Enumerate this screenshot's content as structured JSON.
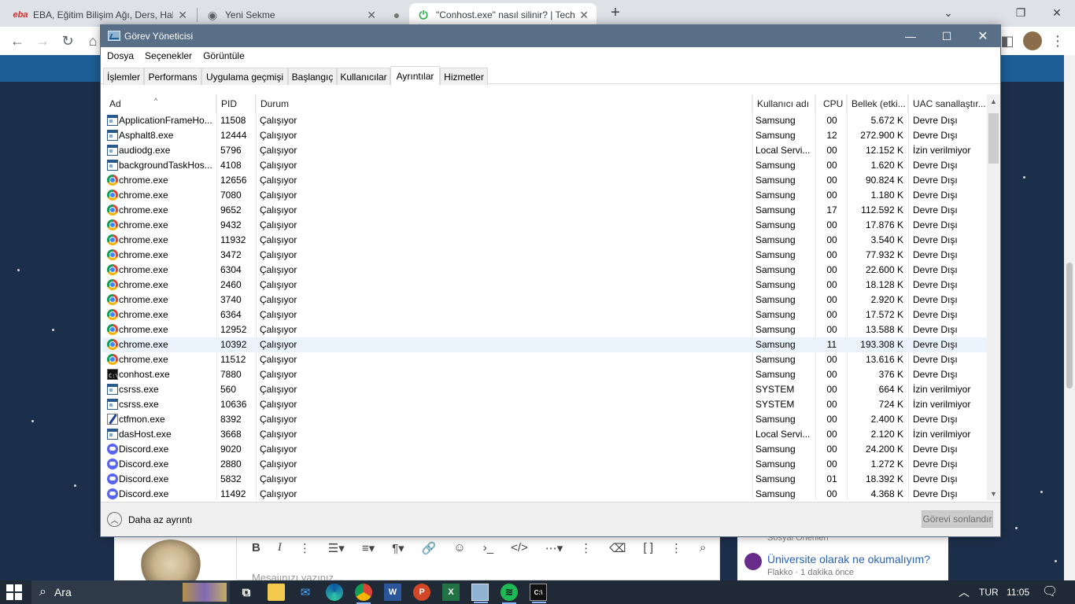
{
  "browser": {
    "tabs": [
      {
        "label": "EBA, Eğitim Bilişim Ağı, Ders, Hab",
        "favicon": "eba"
      },
      {
        "label": "Yeni Sekme"
      },
      {
        "label": "\"Conhost.exe\" nasıl silinir? | Techn"
      }
    ],
    "new_tab_icon": "+",
    "minimize_icon": "⌄",
    "restore_icon": "❐",
    "close_icon": "✕"
  },
  "site": {
    "editor_placeholder": "Mesajınızı yazınız...",
    "side_small": "Sosyal Önerilen",
    "side_title": "Üniversite olarak ne okumalıyım?",
    "side_meta": "Flakko · 1 dakika önce"
  },
  "taskmgr": {
    "title": "Görev Yöneticisi",
    "menu": [
      "Dosya",
      "Seçenekler",
      "Görüntüle"
    ],
    "tabs": [
      "İşlemler",
      "Performans",
      "Uygulama geçmişi",
      "Başlangıç",
      "Kullanıcılar",
      "Ayrıntılar",
      "Hizmetler"
    ],
    "active_tab": "Ayrıntılar",
    "columns": {
      "name": "Ad",
      "pid": "PID",
      "status": "Durum",
      "user": "Kullanıcı adı",
      "cpu": "CPU",
      "mem": "Bellek (etki...",
      "uac": "UAC sanallaştır..."
    },
    "rows": [
      {
        "name": "ApplicationFrameHo...",
        "pid": "11508",
        "status": "Çalışıyor",
        "user": "Samsung",
        "cpu": "00",
        "mem": "5.672 K",
        "uac": "Devre Dışı",
        "icon": "app"
      },
      {
        "name": "Asphalt8.exe",
        "pid": "12444",
        "status": "Çalışıyor",
        "user": "Samsung",
        "cpu": "12",
        "mem": "272.900 K",
        "uac": "Devre Dışı",
        "icon": "app"
      },
      {
        "name": "audiodg.exe",
        "pid": "5796",
        "status": "Çalışıyor",
        "user": "Local Servi...",
        "cpu": "00",
        "mem": "12.152 K",
        "uac": "İzin verilmiyor",
        "icon": "app"
      },
      {
        "name": "backgroundTaskHos...",
        "pid": "4108",
        "status": "Çalışıyor",
        "user": "Samsung",
        "cpu": "00",
        "mem": "1.620 K",
        "uac": "Devre Dışı",
        "icon": "app"
      },
      {
        "name": "chrome.exe",
        "pid": "12656",
        "status": "Çalışıyor",
        "user": "Samsung",
        "cpu": "00",
        "mem": "90.824 K",
        "uac": "Devre Dışı",
        "icon": "chrome"
      },
      {
        "name": "chrome.exe",
        "pid": "7080",
        "status": "Çalışıyor",
        "user": "Samsung",
        "cpu": "00",
        "mem": "1.180 K",
        "uac": "Devre Dışı",
        "icon": "chrome"
      },
      {
        "name": "chrome.exe",
        "pid": "9652",
        "status": "Çalışıyor",
        "user": "Samsung",
        "cpu": "17",
        "mem": "112.592 K",
        "uac": "Devre Dışı",
        "icon": "chrome"
      },
      {
        "name": "chrome.exe",
        "pid": "9432",
        "status": "Çalışıyor",
        "user": "Samsung",
        "cpu": "00",
        "mem": "17.876 K",
        "uac": "Devre Dışı",
        "icon": "chrome"
      },
      {
        "name": "chrome.exe",
        "pid": "11932",
        "status": "Çalışıyor",
        "user": "Samsung",
        "cpu": "00",
        "mem": "3.540 K",
        "uac": "Devre Dışı",
        "icon": "chrome"
      },
      {
        "name": "chrome.exe",
        "pid": "3472",
        "status": "Çalışıyor",
        "user": "Samsung",
        "cpu": "00",
        "mem": "77.932 K",
        "uac": "Devre Dışı",
        "icon": "chrome"
      },
      {
        "name": "chrome.exe",
        "pid": "6304",
        "status": "Çalışıyor",
        "user": "Samsung",
        "cpu": "00",
        "mem": "22.600 K",
        "uac": "Devre Dışı",
        "icon": "chrome"
      },
      {
        "name": "chrome.exe",
        "pid": "2460",
        "status": "Çalışıyor",
        "user": "Samsung",
        "cpu": "00",
        "mem": "18.128 K",
        "uac": "Devre Dışı",
        "icon": "chrome"
      },
      {
        "name": "chrome.exe",
        "pid": "3740",
        "status": "Çalışıyor",
        "user": "Samsung",
        "cpu": "00",
        "mem": "2.920 K",
        "uac": "Devre Dışı",
        "icon": "chrome"
      },
      {
        "name": "chrome.exe",
        "pid": "6364",
        "status": "Çalışıyor",
        "user": "Samsung",
        "cpu": "00",
        "mem": "17.572 K",
        "uac": "Devre Dışı",
        "icon": "chrome"
      },
      {
        "name": "chrome.exe",
        "pid": "12952",
        "status": "Çalışıyor",
        "user": "Samsung",
        "cpu": "00",
        "mem": "13.588 K",
        "uac": "Devre Dışı",
        "icon": "chrome"
      },
      {
        "name": "chrome.exe",
        "pid": "10392",
        "status": "Çalışıyor",
        "user": "Samsung",
        "cpu": "11",
        "mem": "193.308 K",
        "uac": "Devre Dışı",
        "icon": "chrome",
        "selected": true
      },
      {
        "name": "chrome.exe",
        "pid": "11512",
        "status": "Çalışıyor",
        "user": "Samsung",
        "cpu": "00",
        "mem": "13.616 K",
        "uac": "Devre Dışı",
        "icon": "chrome"
      },
      {
        "name": "conhost.exe",
        "pid": "7880",
        "status": "Çalışıyor",
        "user": "Samsung",
        "cpu": "00",
        "mem": "376 K",
        "uac": "Devre Dışı",
        "icon": "cmd"
      },
      {
        "name": "csrss.exe",
        "pid": "560",
        "status": "Çalışıyor",
        "user": "SYSTEM",
        "cpu": "00",
        "mem": "664 K",
        "uac": "İzin verilmiyor",
        "icon": "app"
      },
      {
        "name": "csrss.exe",
        "pid": "10636",
        "status": "Çalışıyor",
        "user": "SYSTEM",
        "cpu": "00",
        "mem": "724 K",
        "uac": "İzin verilmiyor",
        "icon": "app"
      },
      {
        "name": "ctfmon.exe",
        "pid": "8392",
        "status": "Çalışıyor",
        "user": "Samsung",
        "cpu": "00",
        "mem": "2.400 K",
        "uac": "Devre Dışı",
        "icon": "ctf"
      },
      {
        "name": "dasHost.exe",
        "pid": "3668",
        "status": "Çalışıyor",
        "user": "Local Servi...",
        "cpu": "00",
        "mem": "2.120 K",
        "uac": "İzin verilmiyor",
        "icon": "app"
      },
      {
        "name": "Discord.exe",
        "pid": "9020",
        "status": "Çalışıyor",
        "user": "Samsung",
        "cpu": "00",
        "mem": "24.200 K",
        "uac": "Devre Dışı",
        "icon": "discord"
      },
      {
        "name": "Discord.exe",
        "pid": "2880",
        "status": "Çalışıyor",
        "user": "Samsung",
        "cpu": "00",
        "mem": "1.272 K",
        "uac": "Devre Dışı",
        "icon": "discord"
      },
      {
        "name": "Discord.exe",
        "pid": "5832",
        "status": "Çalışıyor",
        "user": "Samsung",
        "cpu": "01",
        "mem": "18.392 K",
        "uac": "Devre Dışı",
        "icon": "discord"
      },
      {
        "name": "Discord.exe",
        "pid": "11492",
        "status": "Çalışıyor",
        "user": "Samsung",
        "cpu": "00",
        "mem": "4.368 K",
        "uac": "Devre Dışı",
        "icon": "discord"
      }
    ],
    "fewer_details": "Daha az ayrıntı",
    "end_task": "Görevi sonlandır"
  },
  "taskbar": {
    "search_label": "Ara",
    "language": "TUR",
    "time": "11:05"
  },
  "colors": {
    "titlebar": "#596e87",
    "selected_row": "#eaf3fc",
    "taskbar": "#202a36",
    "site_header": "#1e5d96"
  }
}
